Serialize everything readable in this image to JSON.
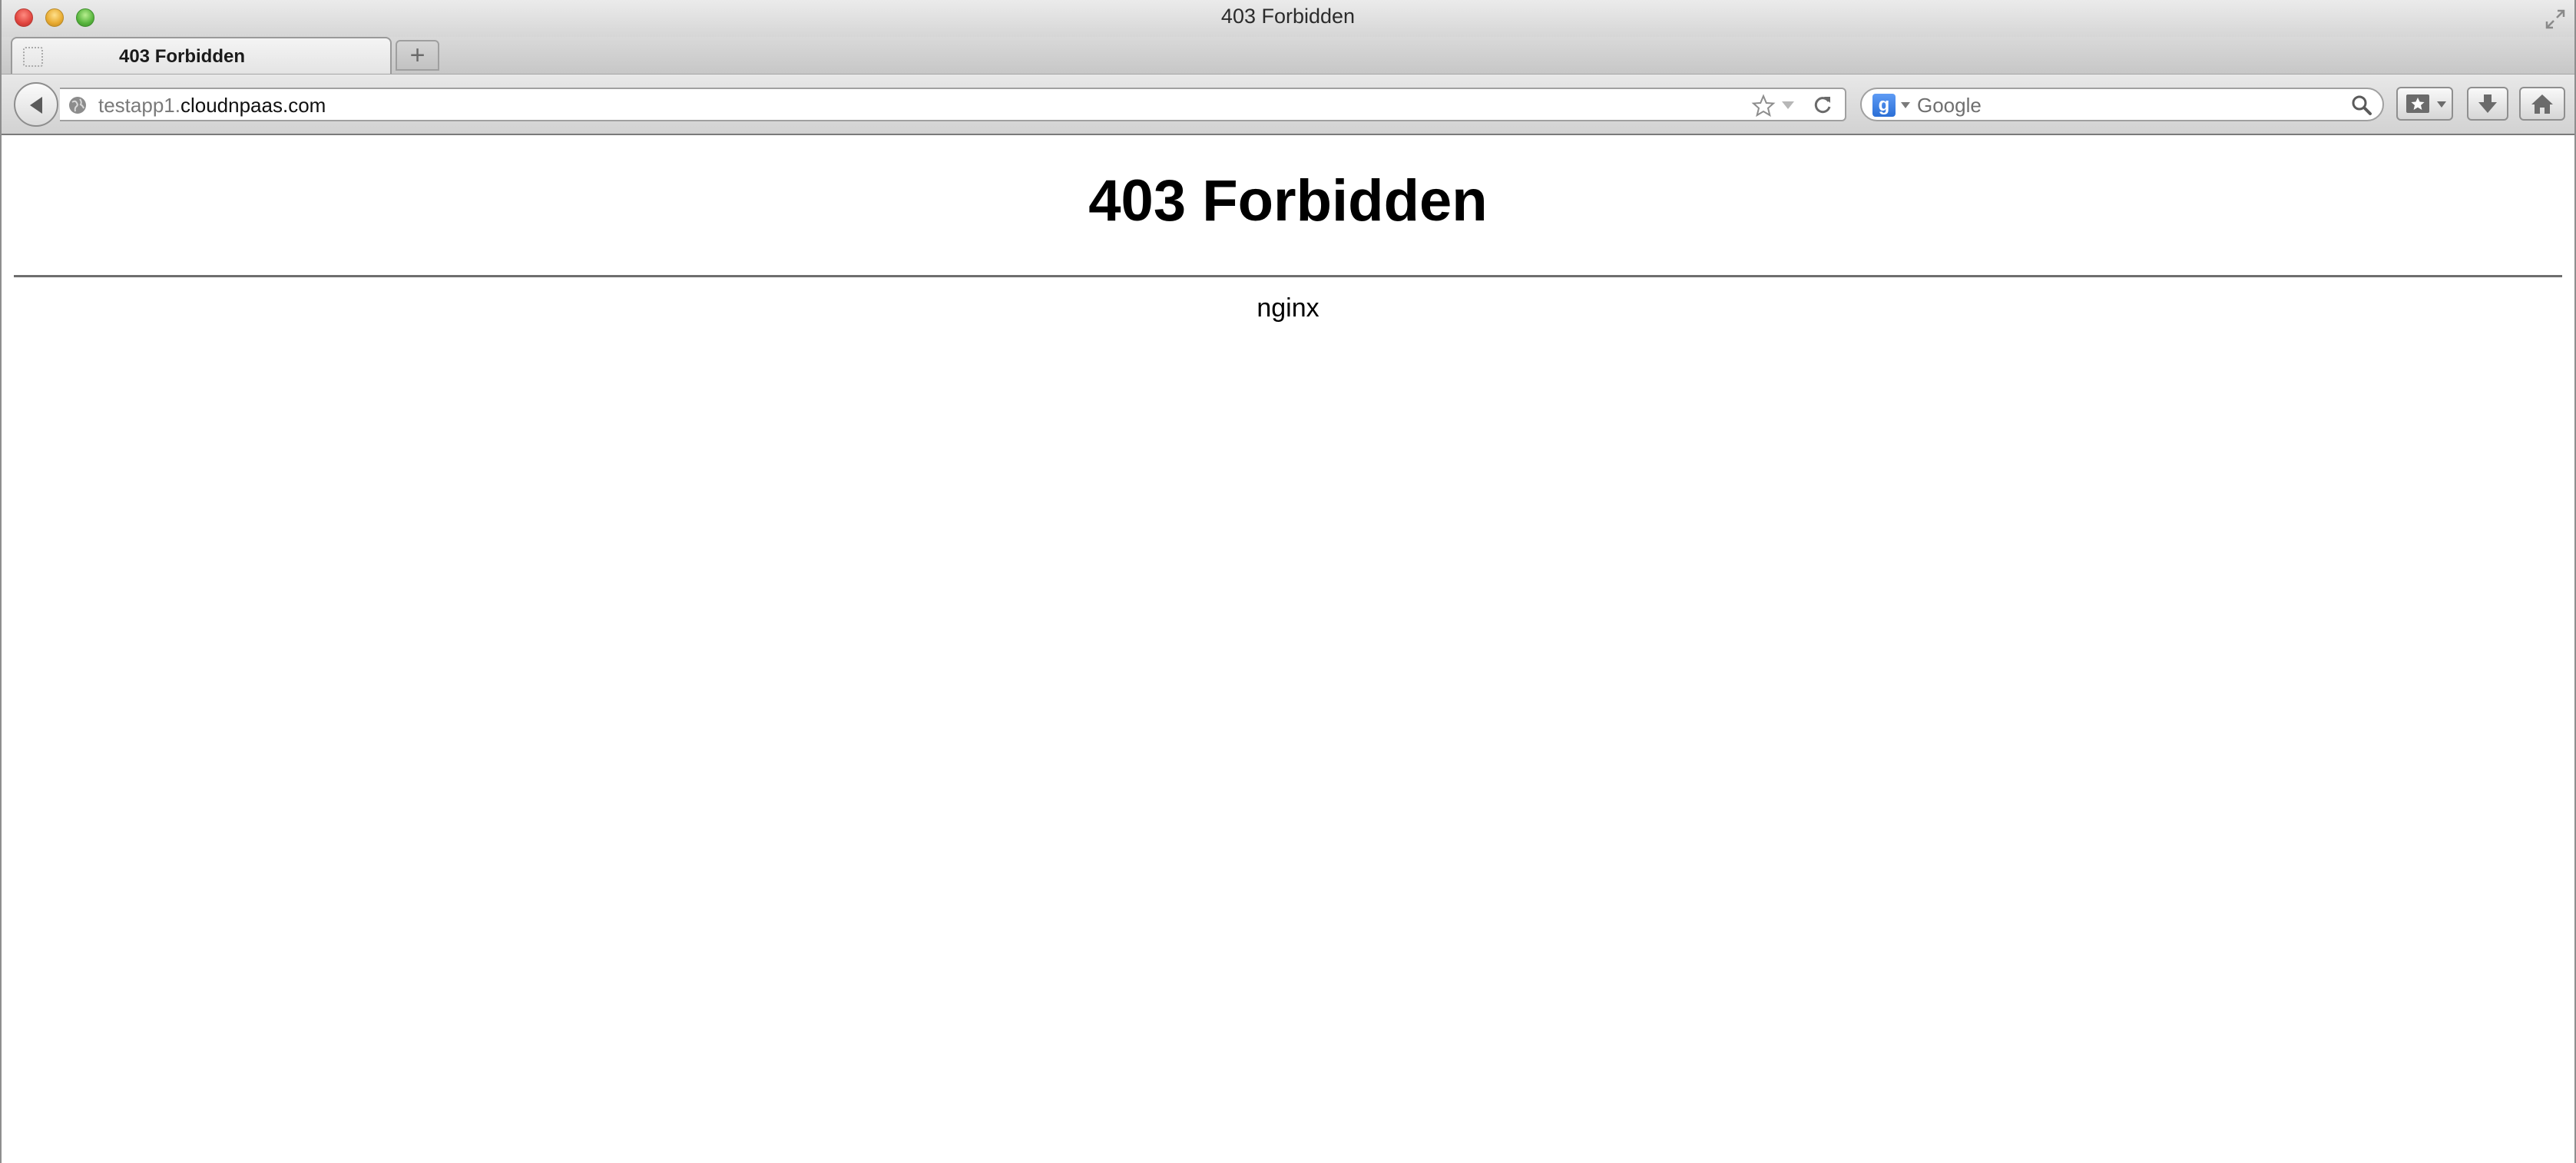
{
  "window": {
    "title": "403 Forbidden"
  },
  "tabs": [
    {
      "label": "403 Forbidden",
      "active": true
    }
  ],
  "new_tab_label": "+",
  "navbar": {
    "url_subdomain": "testapp1.",
    "url_domain": "cloudnpaas.com",
    "search_engine_glyph": "g",
    "search_placeholder": "Google"
  },
  "page": {
    "heading": "403 Forbidden",
    "server": "nginx"
  },
  "colors": {
    "close": "#e0443e",
    "minimize": "#e7a92f",
    "maximize": "#56b43c",
    "search_engine": "#2b6fd6"
  }
}
